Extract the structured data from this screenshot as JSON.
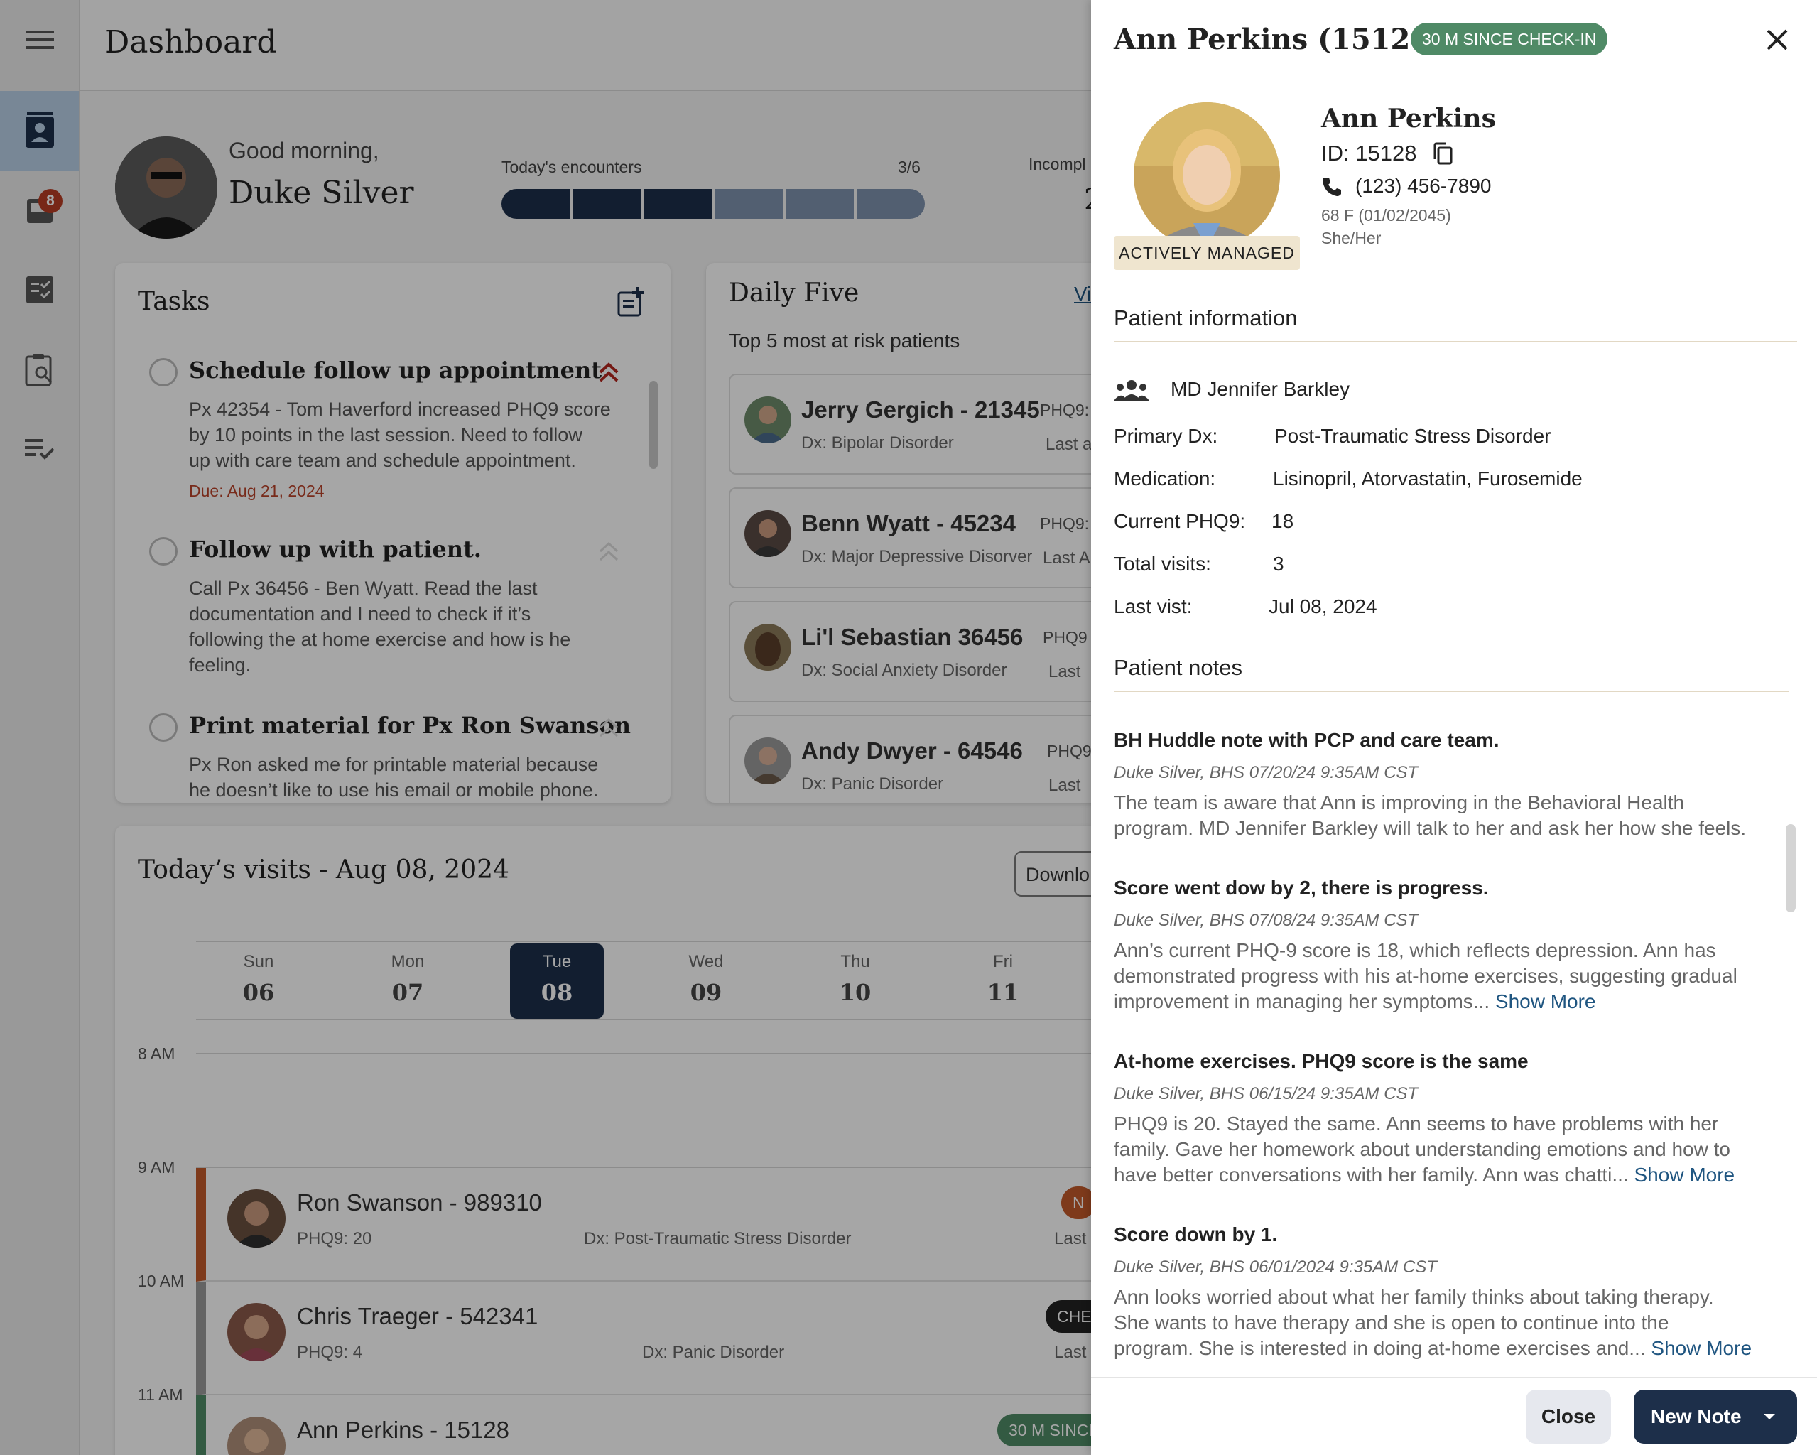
{
  "app": {
    "page_title": "Dashboard"
  },
  "sidebar": {
    "message_badge": "8"
  },
  "greeting": {
    "salutation": "Good morning,",
    "user_name": "Duke Silver"
  },
  "encounters": {
    "label": "Today's encounters",
    "value": "3/6",
    "completed": 3,
    "total": 6,
    "incomplete_label": "Incompl",
    "incomplete_value": "2"
  },
  "tasks": {
    "title": "Tasks",
    "items": [
      {
        "title": "Schedule follow up appointment",
        "lines": [
          "Px 42354 - Tom Haverford increased PHQ9 score",
          "by 10 points in the last session. Need to follow",
          "up with care team and schedule appointment."
        ],
        "due": "Due: Aug 21, 2024"
      },
      {
        "title": "Follow up with patient.",
        "lines": [
          "Call Px 36456 - Ben Wyatt. Read the last",
          "documentation and I need to check if it’s",
          "following the at home exercise and how is he",
          "feeling."
        ]
      },
      {
        "title": "Print material for Px Ron Swanson",
        "lines": [
          "Px Ron asked me for printable material because",
          "he doesn’t like to use his email or mobile phone."
        ]
      }
    ]
  },
  "daily_five": {
    "title": "Daily Five",
    "view_link": "Vi",
    "subtitle": "Top 5 most at risk patients",
    "patients": [
      {
        "name": "Jerry Gergich - 21345",
        "dx": "Dx: Bipolar Disorder",
        "phq": "PHQ9:",
        "last": "Last a"
      },
      {
        "name": "Benn Wyatt - 45234",
        "dx": "Dx: Major Depressive Disorver",
        "phq": "PHQ9:",
        "last": "Last A"
      },
      {
        "name": "Li'l Sebastian 36456",
        "dx": "Dx: Social Anxiety Disorder",
        "phq": "PHQ9",
        "last": "Last"
      },
      {
        "name": "Andy Dwyer - 64546",
        "dx": "Dx: Panic Disorder",
        "phq": "PHQ9",
        "last": "Last"
      }
    ]
  },
  "visits": {
    "title": "Today’s visits - Aug 08, 2024",
    "download_label": "Downlo",
    "days": [
      {
        "name": "Sun",
        "num": "06"
      },
      {
        "name": "Mon",
        "num": "07"
      },
      {
        "name": "Tue",
        "num": "08"
      },
      {
        "name": "Wed",
        "num": "09"
      },
      {
        "name": "Thu",
        "num": "10"
      },
      {
        "name": "Fri",
        "num": "11"
      }
    ],
    "times": [
      "8 AM",
      "9 AM",
      "10 AM",
      "11 AM"
    ],
    "rows": [
      {
        "name": "Ron Swanson - 989310",
        "phq": "PHQ9: 20",
        "dx": "Dx: Post-Traumatic Stress Disorder",
        "last": "Last",
        "status": "N"
      },
      {
        "name": "Chris Traeger - 542341",
        "phq": "PHQ9: 4",
        "dx": "Dx: Panic Disorder",
        "last": "Last",
        "status": "CHEC"
      },
      {
        "name": "Ann Perkins - 15128",
        "status": "30 M SINCE"
      }
    ]
  },
  "panel": {
    "title": "Ann Perkins (15128)",
    "status_pill": "30 M SINCE CHECK-IN",
    "name": "Ann Perkins",
    "id": "ID: 15128",
    "phone": "(123) 456-7890",
    "demographics": "68 F (01/02/2045)",
    "pronouns": "She/Her",
    "management_badge": "ACTIVELY MANAGED",
    "info_heading": "Patient information",
    "care_team": "MD Jennifer Barkley",
    "info": {
      "primary_dx_label": "Primary Dx:",
      "primary_dx": "Post-Traumatic Stress Disorder",
      "medication_label": "Medication:",
      "medication": "Lisinopril, Atorvastatin, Furosemide",
      "phq_label": "Current PHQ9:",
      "phq": "18",
      "visits_label": "Total visits:",
      "visits": "3",
      "last_visit_label": "Last vist:",
      "last_visit": "Jul 08, 2024"
    },
    "notes_heading": "Patient notes",
    "notes": [
      {
        "title": "BH Huddle note with PCP and care team.",
        "meta": "Duke Silver, BHS   07/20/24 9:35AM CST",
        "lines": [
          "The team is aware that Ann is improving in the Behavioral Health",
          "program. MD Jennifer Barkley will talk to her and ask her how she feels."
        ],
        "more": ""
      },
      {
        "title": "Score went dow by 2, there is progress.",
        "meta": "Duke Silver, BHS   07/08/24 9:35AM CST",
        "lines": [
          "Ann’s current PHQ-9 score is 18, which reflects depression. Ann has",
          "demonstrated progress with his at-home exercises, suggesting gradual",
          "improvement in managing her symptoms..."
        ],
        "more": "Show More"
      },
      {
        "title": "At-home exercises. PHQ9 score is the same",
        "meta": "Duke Silver, BHS   06/15/24 9:35AM CST",
        "lines": [
          "PHQ9 is 20. Stayed the same. Ann seems to have problems with her",
          "family. Gave her homework about understanding emotions and how to",
          "have better conversations with her family. Ann was chatti..."
        ],
        "more": "Show More"
      },
      {
        "title": "Score down by 1.",
        "meta": "Duke Silver, BHS   06/01/2024 9:35AM CST",
        "lines": [
          "Ann looks worried about what her family thinks about taking therapy.",
          "She wants to have therapy and she is open to continue into the",
          "program. She is interested in doing at-home exercises and..."
        ],
        "more": "Show More"
      }
    ],
    "close_label": "Close",
    "new_note_label": "New Note"
  },
  "colors": {
    "navy": "#1d2f4a",
    "navy_light": "#7f93ae",
    "green": "#4f8a66",
    "beige": "#efe5cf",
    "orange": "#c25a2a"
  }
}
